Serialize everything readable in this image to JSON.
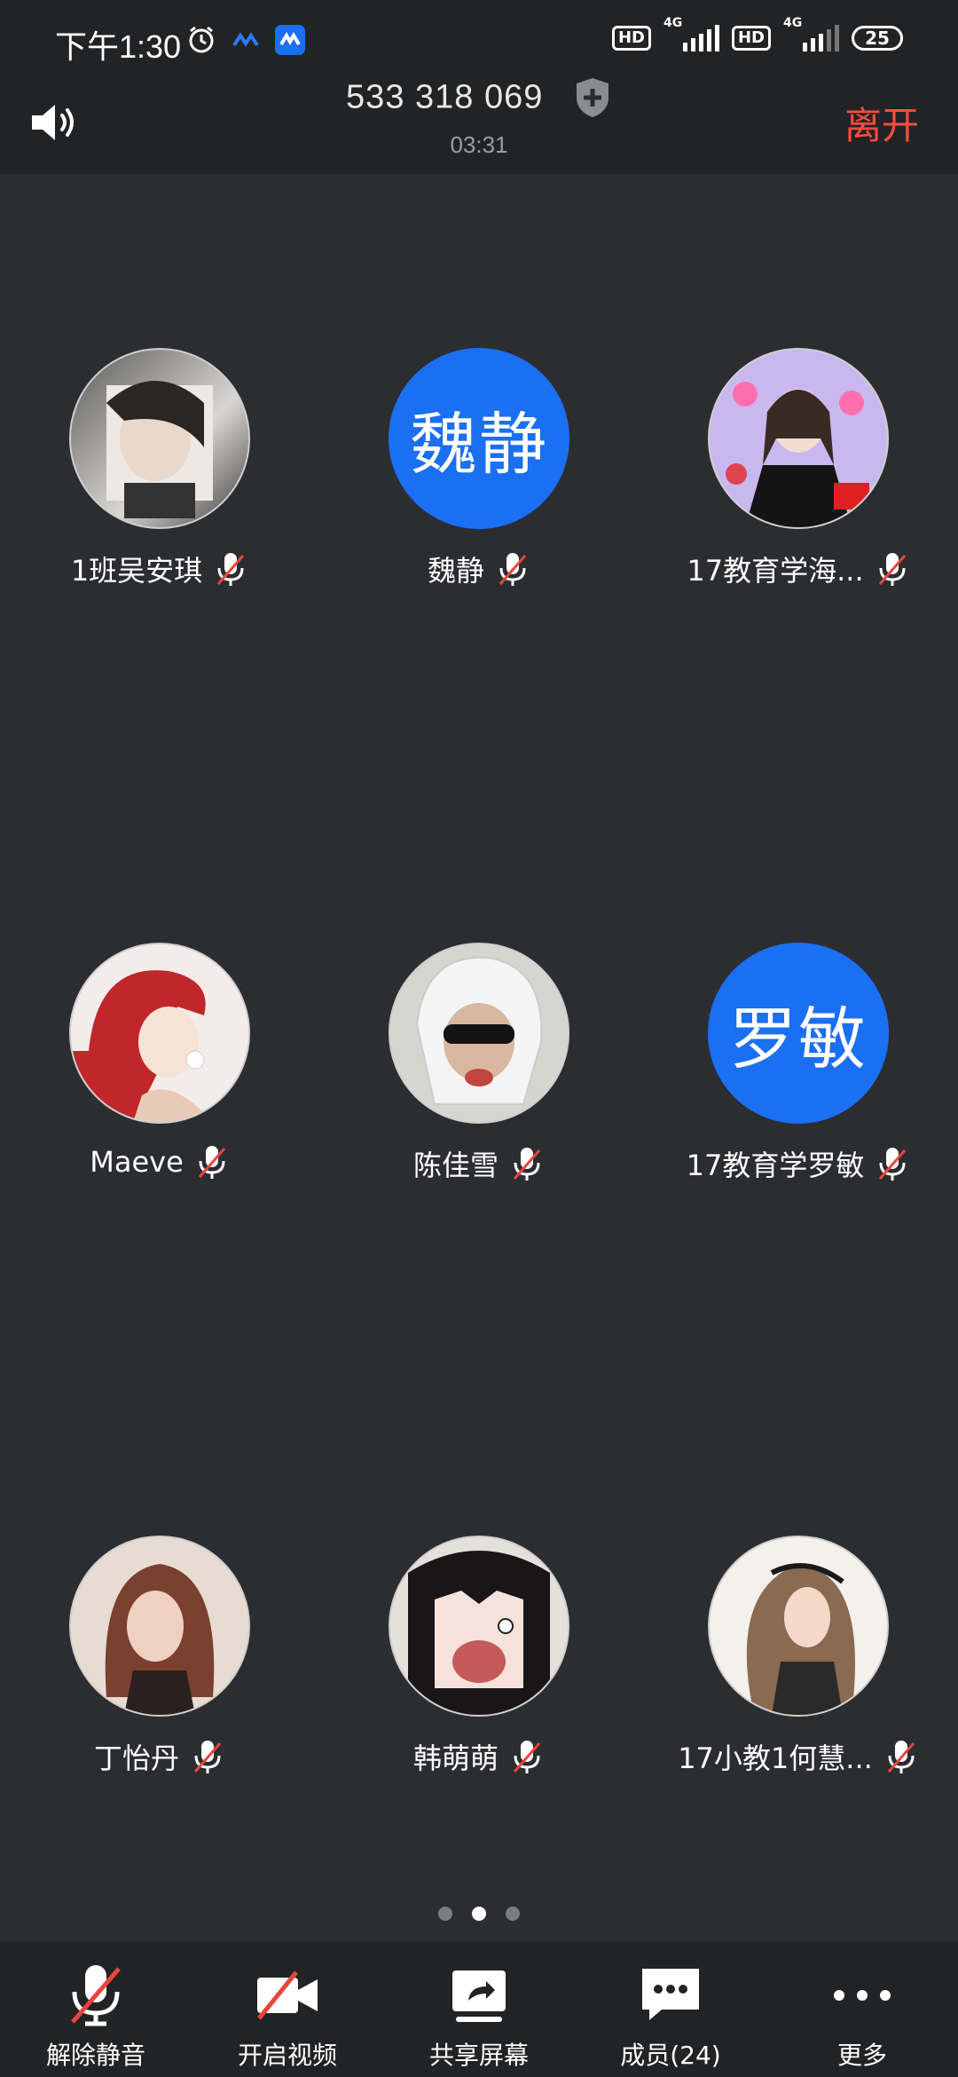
{
  "status_bar": {
    "time": "下午1:30",
    "hd1": "HD",
    "hd2": "HD",
    "net1": "4G",
    "net2": "4G",
    "battery": "25"
  },
  "header": {
    "meeting_id": "533 318 069",
    "duration": "03:31",
    "leave_label": "离开"
  },
  "participants": [
    {
      "name": "1班吴安琪",
      "avatar_type": "photo",
      "avatar_text": ""
    },
    {
      "name": "魏静",
      "avatar_type": "text",
      "avatar_text": "魏静"
    },
    {
      "name": "17教育学海...",
      "avatar_type": "photo",
      "avatar_text": ""
    },
    {
      "name": "Maeve",
      "avatar_type": "photo",
      "avatar_text": ""
    },
    {
      "name": "陈佳雪",
      "avatar_type": "photo",
      "avatar_text": ""
    },
    {
      "name": "17教育学罗敏",
      "avatar_type": "text",
      "avatar_text": "罗敏"
    },
    {
      "name": "丁怡丹",
      "avatar_type": "photo",
      "avatar_text": ""
    },
    {
      "name": "韩萌萌",
      "avatar_type": "photo",
      "avatar_text": ""
    },
    {
      "name": "17小教1何慧...",
      "avatar_type": "photo",
      "avatar_text": ""
    }
  ],
  "pagination": {
    "pages": 3,
    "current": 2
  },
  "toolbar": {
    "unmute_label": "解除静音",
    "video_label": "开启视频",
    "share_label": "共享屏幕",
    "members_label": "成员(24)",
    "more_label": "更多"
  },
  "colors": {
    "background": "#2b2d30",
    "topbar": "#222325",
    "accent_blue": "#1a6ff2",
    "leave_red": "#ff4d3d",
    "mute_red": "#e8453c"
  }
}
